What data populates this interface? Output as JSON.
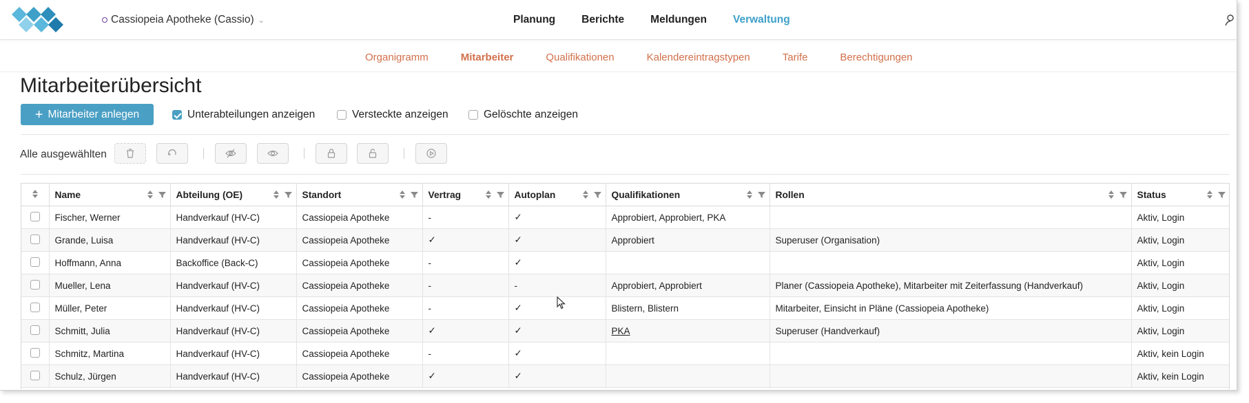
{
  "header": {
    "org": "Cassiopeia Apotheke (Cassio)",
    "nav": [
      "Planung",
      "Berichte",
      "Meldungen",
      "Verwaltung"
    ],
    "active_nav": "Verwaltung"
  },
  "subnav": {
    "items": [
      "Organigramm",
      "Mitarbeiter",
      "Qualifikationen",
      "Kalendereintragstypen",
      "Tarife",
      "Berechtigungen"
    ],
    "active": "Mitarbeiter"
  },
  "page_title": "Mitarbeiterübersicht",
  "actions": {
    "add_button": "Mitarbeiter anlegen",
    "show_subdepartments": "Unterabteilungen anzeigen",
    "show_subdepartments_checked": true,
    "show_hidden": "Versteckte anzeigen",
    "show_hidden_checked": false,
    "show_deleted": "Gelöschte anzeigen",
    "show_deleted_checked": false
  },
  "bulk": {
    "label": "Alle ausgewählten",
    "buttons": [
      "trash-icon",
      "restore-icon",
      "hide-icon",
      "show-icon",
      "lock-icon",
      "unlock-icon",
      "play-icon"
    ]
  },
  "table": {
    "columns": [
      "Name",
      "Abteilung (OE)",
      "Standort",
      "Vertrag",
      "Autoplan",
      "Qualifikationen",
      "Rollen",
      "Status"
    ],
    "rows": [
      {
        "name": "Fischer, Werner",
        "abteilung": "Handverkauf (HV-C)",
        "standort": "Cassiopeia Apotheke",
        "vertrag": "-",
        "autoplan": "✓",
        "qualifikationen": "Approbiert, Approbiert, PKA",
        "rollen": "",
        "status": "Aktiv, Login"
      },
      {
        "name": "Grande, Luisa",
        "abteilung": "Handverkauf (HV-C)",
        "standort": "Cassiopeia Apotheke",
        "vertrag": "✓",
        "autoplan": "✓",
        "qualifikationen": "Approbiert",
        "rollen": "Superuser (Organisation)",
        "status": "Aktiv, Login"
      },
      {
        "name": "Hoffmann, Anna",
        "abteilung": "Backoffice (Back-C)",
        "standort": "Cassiopeia Apotheke",
        "vertrag": "-",
        "autoplan": "✓",
        "qualifikationen": "",
        "rollen": "",
        "status": "Aktiv, Login"
      },
      {
        "name": "Mueller, Lena",
        "abteilung": "Handverkauf (HV-C)",
        "standort": "Cassiopeia Apotheke",
        "vertrag": "-",
        "autoplan": "-",
        "qualifikationen": "Approbiert, Approbiert",
        "rollen": "Planer (Cassiopeia Apotheke), Mitarbeiter mit Zeiterfassung (Handverkauf)",
        "status": "Aktiv, Login"
      },
      {
        "name": "Müller, Peter",
        "abteilung": "Handverkauf (HV-C)",
        "standort": "Cassiopeia Apotheke",
        "vertrag": "-",
        "autoplan": "✓",
        "qualifikationen": "Blistern, Blistern",
        "rollen": "Mitarbeiter, Einsicht in Pläne (Cassiopeia Apotheke)",
        "status": "Aktiv, Login"
      },
      {
        "name": "Schmitt, Julia",
        "abteilung": "Handverkauf (HV-C)",
        "standort": "Cassiopeia Apotheke",
        "vertrag": "✓",
        "autoplan": "✓",
        "qualifikationen": "PKA",
        "qual_link": true,
        "rollen": "Superuser (Handverkauf)",
        "status": "Aktiv, Login"
      },
      {
        "name": "Schmitz, Martina",
        "abteilung": "Handverkauf (HV-C)",
        "standort": "Cassiopeia Apotheke",
        "vertrag": "-",
        "autoplan": "✓",
        "qualifikationen": "",
        "rollen": "",
        "status": "Aktiv, kein Login"
      },
      {
        "name": "Schulz, Jürgen",
        "abteilung": "Handverkauf (HV-C)",
        "standort": "Cassiopeia Apotheke",
        "vertrag": "✓",
        "autoplan": "✓",
        "qualifikationen": "",
        "rollen": "",
        "status": "Aktiv, kein Login"
      }
    ]
  },
  "colors": {
    "accent": "#3ea0c9",
    "primary_button": "#4a9fc4",
    "subnav": "#d2704b"
  }
}
